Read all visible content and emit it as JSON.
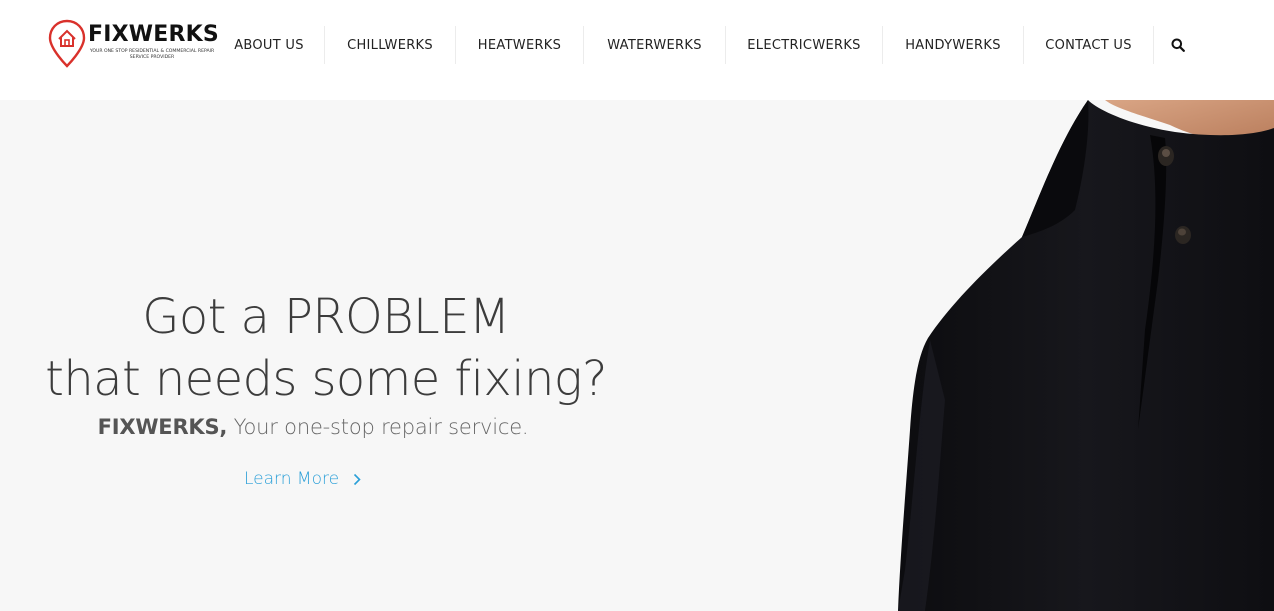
{
  "brand": {
    "name": "FIXWERKS",
    "tagline": "YOUR ONE STOP RESIDENTIAL & COMMERCIAL REPAIR SERVICE PROVIDER",
    "accent_color": "#d9312b"
  },
  "nav": {
    "items": [
      {
        "label": "ABOUT US"
      },
      {
        "label": "CHILLWERKS"
      },
      {
        "label": "HEATWERKS"
      },
      {
        "label": "WATERWERKS"
      },
      {
        "label": "ELECTRICWERKS"
      },
      {
        "label": "HANDYWERKS"
      },
      {
        "label": "CONTACT US"
      }
    ],
    "search_icon": "search-icon"
  },
  "hero": {
    "headline_line1": "Got a PROBLEM",
    "headline_line2": "that needs some fixing?",
    "subline_brand": "FIXWERKS,",
    "subline_text": " Your one-stop repair service.",
    "cta_label": "Learn More",
    "cta_icon": "chevron-right-icon",
    "cta_color": "#2a9fd8"
  }
}
